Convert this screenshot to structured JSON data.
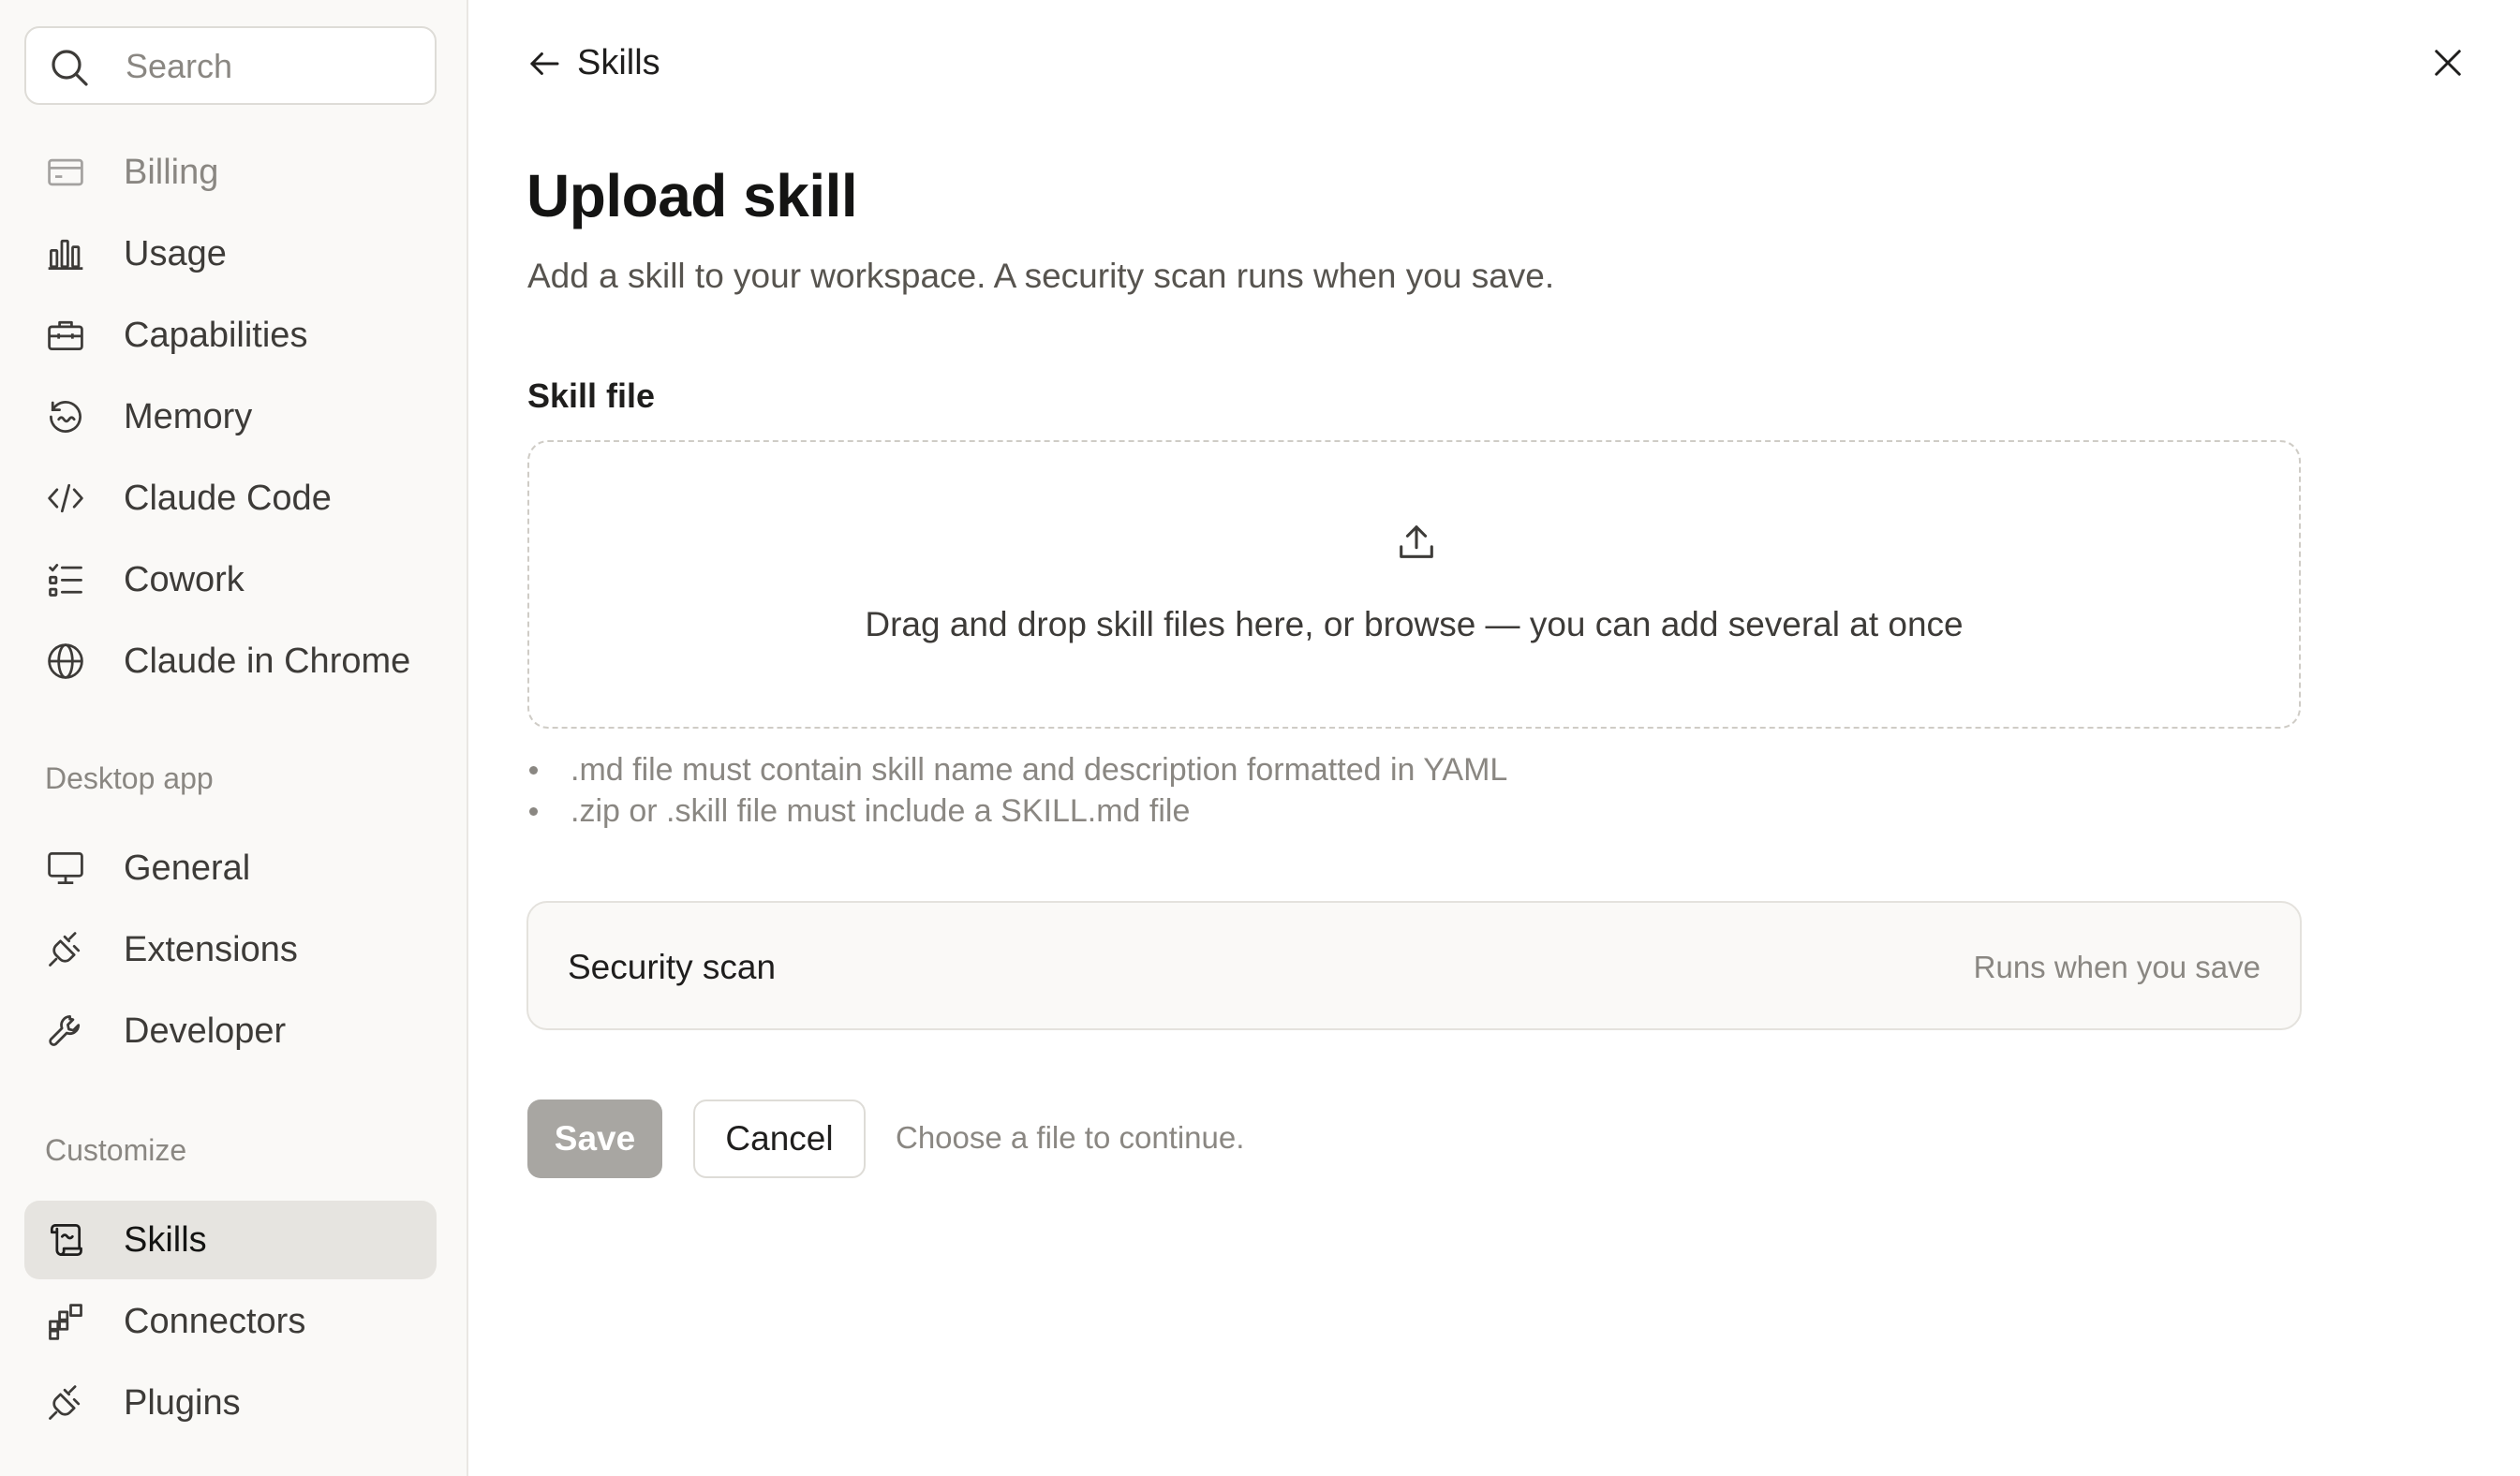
{
  "search": {
    "placeholder": "Search"
  },
  "sidebar": {
    "items": [
      {
        "label": "Billing",
        "icon": "credit-card-icon"
      },
      {
        "label": "Usage",
        "icon": "bar-chart-icon"
      },
      {
        "label": "Capabilities",
        "icon": "briefcase-icon"
      },
      {
        "label": "Memory",
        "icon": "memory-icon"
      },
      {
        "label": "Claude Code",
        "icon": "code-icon"
      },
      {
        "label": "Cowork",
        "icon": "checklist-icon"
      },
      {
        "label": "Claude in Chrome",
        "icon": "globe-icon"
      }
    ],
    "desktop_section": "Desktop app",
    "desktop_items": [
      {
        "label": "General",
        "icon": "monitor-icon"
      },
      {
        "label": "Extensions",
        "icon": "plug-icon"
      },
      {
        "label": "Developer",
        "icon": "wrench-icon"
      }
    ],
    "customize_section": "Customize",
    "customize_items": [
      {
        "label": "Skills",
        "icon": "scroll-icon",
        "active": true
      },
      {
        "label": "Connectors",
        "icon": "connectors-icon"
      },
      {
        "label": "Plugins",
        "icon": "plug-icon"
      }
    ]
  },
  "header": {
    "back_label": "Skills"
  },
  "main": {
    "title": "Upload skill",
    "subtitle": "Add a skill to your workspace. A security scan runs when you save.",
    "field_label": "Skill file",
    "dropzone_text": "Drag and drop skill files here, or browse — you can add several at once",
    "hints": [
      ".md file must contain skill name and description formatted in YAML",
      ".zip or .skill file must include a SKILL.md file"
    ],
    "scan": {
      "title": "Security scan",
      "status": "Runs when you save"
    },
    "save_label": "Save",
    "cancel_label": "Cancel",
    "note": "Choose a file to continue."
  },
  "colors": {
    "sidebar_bg": "#faf9f7",
    "active_bg": "#e6e4e0",
    "disabled_button": "#a8a6a2"
  }
}
